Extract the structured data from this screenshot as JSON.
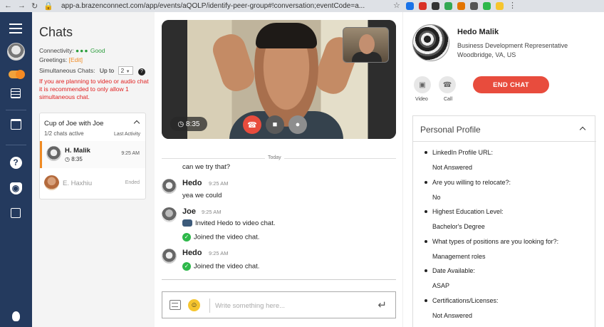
{
  "browser": {
    "url": "app-a.brazenconnect.com/app/events/aQOLP/identify-peer-group#!conversation;eventCode=a..."
  },
  "colors": {
    "nav_bg": "#243a5e",
    "accent": "#f08a22",
    "danger": "#e84c3d",
    "success": "#2eb84a"
  },
  "chats_panel": {
    "title": "Chats",
    "connectivity_label": "Connectivity:",
    "connectivity_status": "Good",
    "greetings_label": "Greetings:",
    "greetings_edit": "[Edit]",
    "simultaneous_label": "Simultaneous Chats:",
    "simultaneous_prefix": "Up to",
    "simultaneous_value": "2",
    "warning": "If you are planning to video or audio chat it is recommended to only allow 1 simultaneous chat.",
    "group": {
      "name": "Cup of Joe with Joe",
      "active": "1/2 chats active",
      "sort": "Last Activity",
      "items": [
        {
          "name": "H. Malik",
          "timer": "8:35",
          "time": "9:25 AM"
        },
        {
          "name": "E. Haxhiu",
          "status": "Ended"
        }
      ]
    }
  },
  "video": {
    "timer": "8:35"
  },
  "conversation": {
    "day": "Today",
    "messages": [
      {
        "text": "can we try that?"
      },
      {
        "name": "Hedo",
        "time": "9:25 AM",
        "text": "yea we could"
      },
      {
        "name": "Joe",
        "time": "9:25 AM",
        "lines": [
          "Invited Hedo to video chat.",
          "Joined the video chat."
        ]
      },
      {
        "name": "Hedo",
        "time": "9:25 AM",
        "text": "Joined the video chat."
      }
    ],
    "composer_placeholder": "Write something here..."
  },
  "profile": {
    "name": "Hedo Malik",
    "title": "Business Development Representative",
    "location": "Woodbridge, VA, US",
    "video_label": "Video",
    "call_label": "Call",
    "end_chat": "END CHAT",
    "section_title": "Personal Profile",
    "fields": [
      {
        "q": "LinkedIn Profile URL:",
        "a": "Not Answered"
      },
      {
        "q": "Are you willing to relocate?:",
        "a": "No"
      },
      {
        "q": "Highest Education Level:",
        "a": "Bachelor's Degree"
      },
      {
        "q": "What types of positions are you looking for?:",
        "a": "Management roles"
      },
      {
        "q": "Date Available:",
        "a": "ASAP"
      },
      {
        "q": "Certifications/Licenses:",
        "a": "Not Answered"
      }
    ]
  }
}
